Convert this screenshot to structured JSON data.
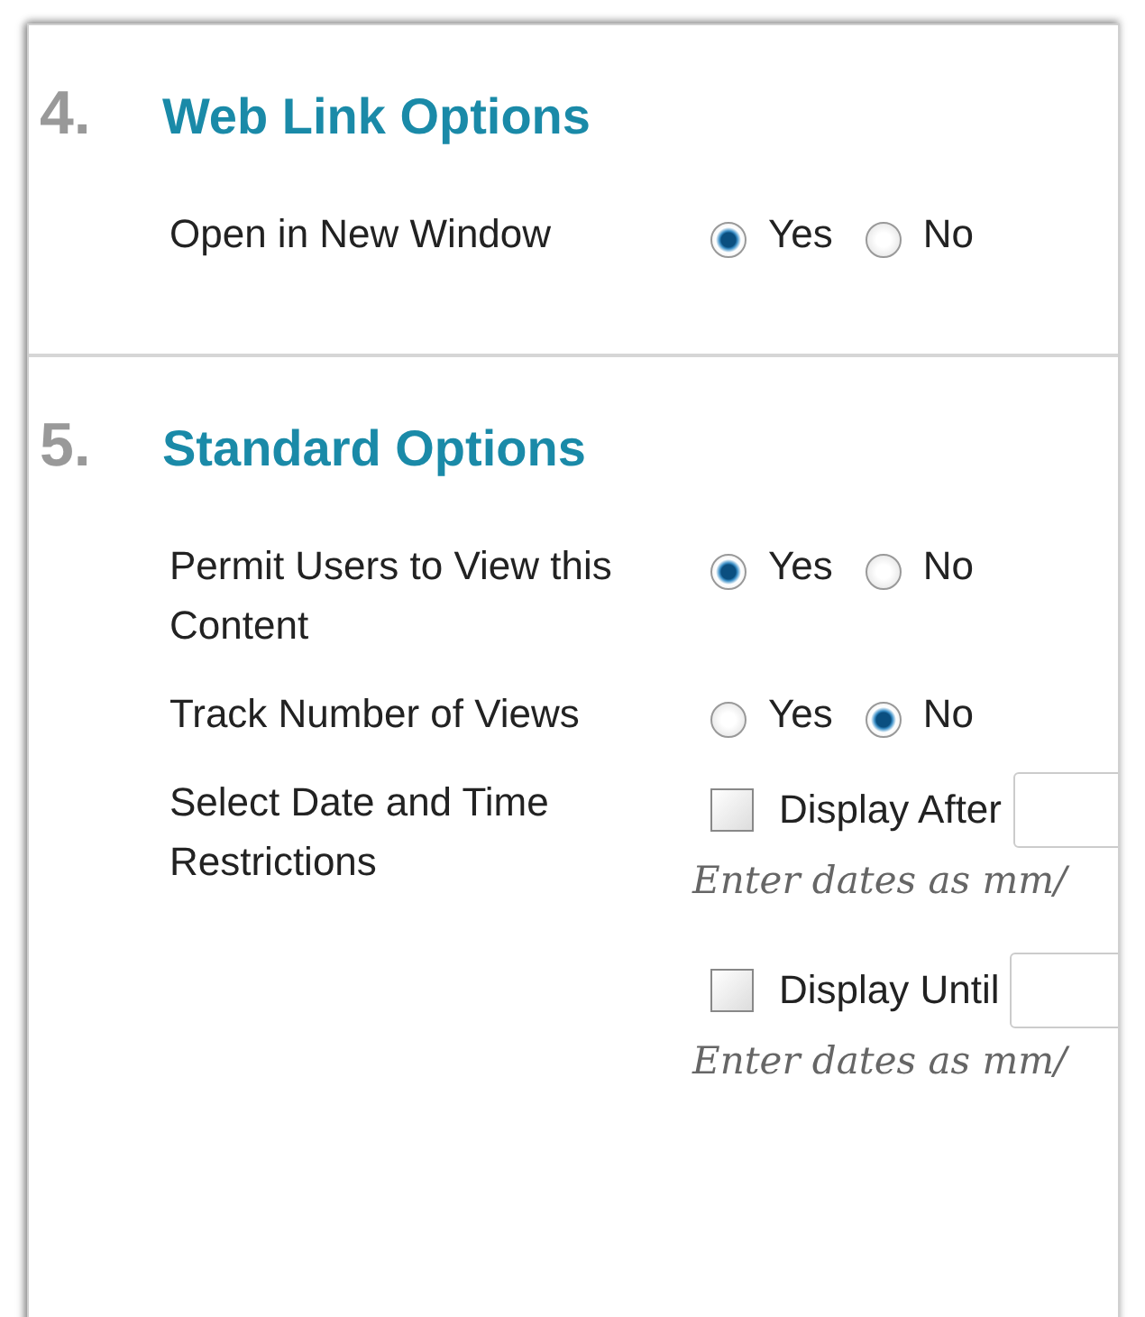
{
  "sections": [
    {
      "number": "4.",
      "title": "Web Link Options",
      "rows": [
        {
          "kind": "radio",
          "label": "Open in New Window",
          "options": [
            {
              "label": "Yes",
              "selected": true
            },
            {
              "label": "No",
              "selected": false
            }
          ]
        }
      ]
    },
    {
      "number": "5.",
      "title": "Standard Options",
      "rows": [
        {
          "kind": "radio",
          "label": "Permit Users to View this Content",
          "options": [
            {
              "label": "Yes",
              "selected": true
            },
            {
              "label": "No",
              "selected": false
            }
          ]
        },
        {
          "kind": "radio",
          "label": "Track Number of Views",
          "options": [
            {
              "label": "Yes",
              "selected": false
            },
            {
              "label": "No",
              "selected": true
            }
          ]
        },
        {
          "kind": "dates",
          "label": "Select Date and Time Restrictions",
          "dates": [
            {
              "label": "Display After",
              "checked": false,
              "hint": "Enter dates as mm/"
            },
            {
              "label": "Display Until",
              "checked": false,
              "hint": "Enter dates as mm/"
            }
          ]
        }
      ]
    }
  ]
}
